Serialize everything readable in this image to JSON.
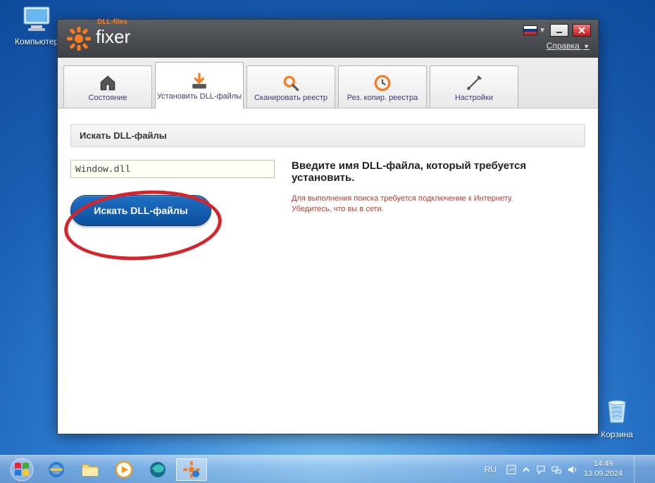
{
  "desktop": {
    "computer_label": "Компьютер",
    "recycle_label": "Корзина"
  },
  "app": {
    "brand_sup": "DLL-files",
    "brand_name": "fixer",
    "help_label": "Справка",
    "tabs": [
      {
        "label": "Состояние"
      },
      {
        "label": "Установить DLL-файлы"
      },
      {
        "label": "Сканировать реестр"
      },
      {
        "label": "Рез. копир. реестра"
      },
      {
        "label": "Настройки"
      }
    ],
    "section_title": "Искать DLL-файлы",
    "search_value": "Window.dll",
    "search_button": "Искать DLL-файлы",
    "instruction_heading": "Введите имя DLL-файла, который требуется установить.",
    "warning_line1": "Для выполнения поиска требуется подключение к Интернету.",
    "warning_line2": "Убедитесь, что вы в сети."
  },
  "taskbar": {
    "language": "RU",
    "time": "14:49",
    "date": "13.09.2024"
  }
}
